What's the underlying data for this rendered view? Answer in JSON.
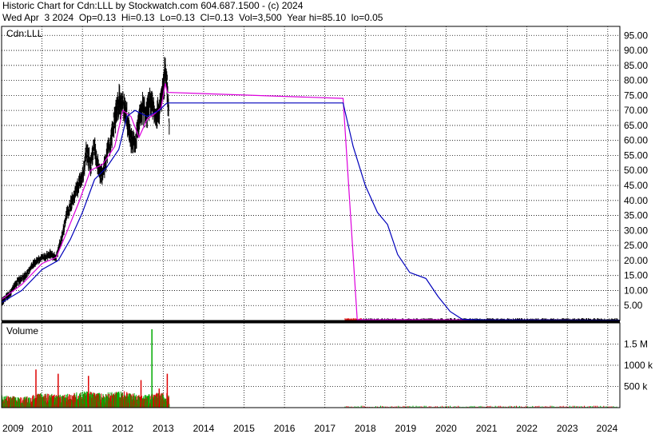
{
  "header": {
    "line1": "Historic Chart for Cdn:LLL by Stockwatch.com 604.687.1500 - (c) 2024",
    "line2": "Wed Apr  3 2024  Op=0.13  Hi=0.13  Lo=0.13  Cl=0.13  Vol=3,500  Year hi=85.10  lo=0.05"
  },
  "chart_data": [
    {
      "type": "line",
      "panel": "price",
      "title": "Cdn:LLL",
      "x_unit": "year",
      "xlim": [
        2009.0,
        2024.3
      ],
      "ylim": [
        0,
        98
      ],
      "y_ticks": [
        5,
        10,
        15,
        20,
        25,
        30,
        35,
        40,
        45,
        50,
        55,
        60,
        65,
        70,
        75,
        80,
        85,
        90,
        95
      ],
      "y_tick_labels": [
        "5.00",
        "10.00",
        "15.00",
        "20.00",
        "25.00",
        "30.00",
        "35.00",
        "40.00",
        "45.00",
        "50.00",
        "55.00",
        "60.00",
        "65.00",
        "70.00",
        "75.00",
        "80.00",
        "85.00",
        "90.00",
        "95.00"
      ],
      "x_ticks": [
        2009,
        2010,
        2011,
        2012,
        2013,
        2014,
        2015,
        2016,
        2017,
        2018,
        2019,
        2020,
        2021,
        2022,
        2023,
        2024
      ],
      "x_tick_labels": [
        "2009",
        "2010",
        "2011",
        "2012",
        "2013",
        "2014",
        "2015",
        "2016",
        "2017",
        "2018",
        "2019",
        "2020",
        "2021",
        "2022",
        "2023",
        "2024"
      ],
      "grid": true,
      "colors": {
        "bars": "#000000",
        "ma_short": "#dd00dd",
        "ma_long": "#0000bb",
        "up_volume": "#00aa00",
        "down_volume": "#dd0000",
        "grid": "#000000"
      },
      "price_path": [
        [
          2009.0,
          6
        ],
        [
          2009.2,
          9
        ],
        [
          2009.4,
          13
        ],
        [
          2009.6,
          15
        ],
        [
          2009.8,
          19
        ],
        [
          2010.0,
          21
        ],
        [
          2010.2,
          22
        ],
        [
          2010.35,
          21
        ],
        [
          2010.5,
          28
        ],
        [
          2010.6,
          35
        ],
        [
          2010.75,
          40
        ],
        [
          2010.9,
          45
        ],
        [
          2011.0,
          48
        ],
        [
          2011.1,
          56
        ],
        [
          2011.2,
          52
        ],
        [
          2011.3,
          58
        ],
        [
          2011.4,
          50
        ],
        [
          2011.5,
          48
        ],
        [
          2011.6,
          55
        ],
        [
          2011.7,
          60
        ],
        [
          2011.8,
          67
        ],
        [
          2011.9,
          73
        ],
        [
          2012.0,
          72
        ],
        [
          2012.1,
          68
        ],
        [
          2012.2,
          60
        ],
        [
          2012.3,
          58
        ],
        [
          2012.4,
          66
        ],
        [
          2012.5,
          71
        ],
        [
          2012.6,
          69
        ],
        [
          2012.7,
          73
        ],
        [
          2012.8,
          68
        ],
        [
          2012.9,
          70
        ],
        [
          2013.0,
          77
        ],
        [
          2013.05,
          84
        ],
        [
          2013.1,
          78
        ],
        [
          2013.15,
          65
        ]
      ],
      "series": [
        {
          "name": "",
          "color": "#dd00dd",
          "points": [
            [
              2009.0,
              7
            ],
            [
              2009.5,
              12
            ],
            [
              2010.0,
              19
            ],
            [
              2010.35,
              21
            ],
            [
              2010.6,
              29
            ],
            [
              2010.9,
              39
            ],
            [
              2011.2,
              50
            ],
            [
              2011.5,
              52
            ],
            [
              2011.8,
              58
            ],
            [
              2012.0,
              70
            ],
            [
              2012.2,
              68
            ],
            [
              2012.4,
              61
            ],
            [
              2012.6,
              67
            ],
            [
              2012.8,
              69
            ],
            [
              2012.95,
              71
            ],
            [
              2013.05,
              79
            ],
            [
              2013.1,
              76
            ],
            [
              2017.45,
              74
            ],
            [
              2017.8,
              0.3
            ],
            [
              2024.3,
              0.1
            ]
          ]
        },
        {
          "name": "",
          "color": "#0000bb",
          "points": [
            [
              2009.0,
              6
            ],
            [
              2009.5,
              10
            ],
            [
              2010.0,
              17
            ],
            [
              2010.4,
              20
            ],
            [
              2010.7,
              27
            ],
            [
              2011.0,
              36
            ],
            [
              2011.3,
              47
            ],
            [
              2011.6,
              51
            ],
            [
              2011.9,
              57
            ],
            [
              2012.1,
              68
            ],
            [
              2012.3,
              70
            ],
            [
              2012.6,
              68
            ],
            [
              2012.9,
              70
            ],
            [
              2013.05,
              72
            ],
            [
              2013.1,
              72.5
            ],
            [
              2017.45,
              72.5
            ],
            [
              2017.7,
              58
            ],
            [
              2018.0,
              45
            ],
            [
              2018.3,
              36
            ],
            [
              2018.55,
              32
            ],
            [
              2018.8,
              22
            ],
            [
              2019.1,
              16
            ],
            [
              2019.5,
              14
            ],
            [
              2019.8,
              8
            ],
            [
              2020.1,
              3
            ],
            [
              2020.4,
              0.4
            ],
            [
              2021.0,
              0.2
            ],
            [
              2024.3,
              0.1
            ]
          ]
        }
      ]
    },
    {
      "type": "bar",
      "panel": "volume",
      "title": "Volume",
      "ylim": [
        0,
        2000000
      ],
      "y_ticks": [
        500000,
        1000000,
        1500000
      ],
      "y_tick_labels": [
        "500 k",
        "1000 k",
        "1.5 M"
      ],
      "volume_envelope": [
        [
          2009.0,
          300000
        ],
        [
          2009.5,
          250000
        ],
        [
          2010.0,
          350000
        ],
        [
          2010.5,
          300000
        ],
        [
          2011.0,
          400000
        ],
        [
          2011.5,
          350000
        ],
        [
          2012.0,
          400000
        ],
        [
          2012.5,
          300000
        ],
        [
          2012.8,
          350000
        ],
        [
          2013.1,
          350000
        ]
      ],
      "volume_spikes": [
        [
          2009.85,
          900000
        ],
        [
          2010.4,
          800000
        ],
        [
          2011.15,
          750000
        ],
        [
          2012.45,
          650000
        ],
        [
          2012.72,
          1850000
        ],
        [
          2012.9,
          450000
        ],
        [
          2013.1,
          800000
        ]
      ]
    }
  ]
}
